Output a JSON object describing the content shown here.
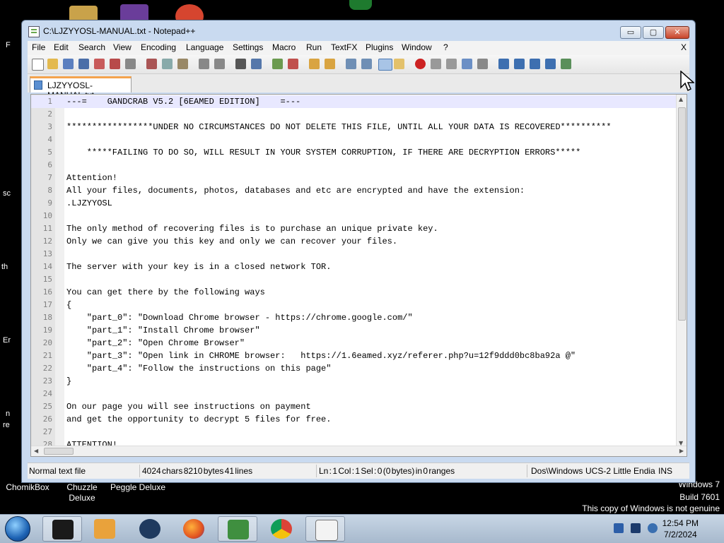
{
  "window": {
    "title": "C:\\LJZYYOSL-MANUAL.txt - Notepad++",
    "controls": {
      "minimize": "▭",
      "maximize": "▢",
      "close": "✕"
    }
  },
  "menu": {
    "items": [
      "File",
      "Edit",
      "Search",
      "View",
      "Encoding",
      "Language",
      "Settings",
      "Macro",
      "Run",
      "TextFX",
      "Plugins",
      "Window",
      "?"
    ],
    "close_doc": "X"
  },
  "tab": {
    "label": "LJZYYOSL-MANUAL.txt"
  },
  "editor": {
    "lines": [
      "---=    GANDCRAB V5.2 [6EAMED EDITION]    =---",
      "",
      "*****************UNDER NO CIRCUMSTANCES DO NOT DELETE THIS FILE, UNTIL ALL YOUR DATA IS RECOVERED**********",
      "",
      "    *****FAILING TO DO SO, WILL RESULT IN YOUR SYSTEM CORRUPTION, IF THERE ARE DECRYPTION ERRORS*****",
      "",
      "Attention!",
      "All your files, documents, photos, databases and etc are encrypted and have the extension:",
      ".LJZYYOSL",
      "",
      "The only method of recovering files is to purchase an unique private key.",
      "Only we can give you this key and only we can recover your files.",
      "",
      "The server with your key is in a closed network TOR.",
      "",
      "You can get there by the following ways",
      "{",
      "    \"part_0\": \"Download Chrome browser - https://chrome.google.com/\"",
      "    \"part_1\": \"Install Chrome browser\"",
      "    \"part_2\": \"Open Chrome Browser\"",
      "    \"part_3\": \"Open link in CHROME browser:   https://1.6eamed.xyz/referer.php?u=12f9ddd0bc8ba92a @\"",
      "    \"part_4\": \"Follow the instructions on this page\"",
      "}",
      "",
      "On our page you will see instructions on payment",
      "and get the opportunity to decrypt 5 files for free.",
      "",
      "ATTENTION!"
    ]
  },
  "status": {
    "type": "Normal text file",
    "counts": "4024 chars   8210 bytes   41 lines",
    "position": "Ln : 1    Col : 1    Sel : 0 (0 bytes) in 0 ranges",
    "eol": "Dos\\Windows",
    "encoding": "UCS-2 Little Endia",
    "mode": "INS"
  },
  "desktop": {
    "icons": [
      {
        "label": "ChomikBox"
      },
      {
        "label": "Chuzzle\nDeluxe"
      },
      {
        "label": "Peggle Deluxe"
      }
    ],
    "edge_text": [
      "F",
      "sc",
      "th",
      "Er",
      "n",
      "re"
    ],
    "watermark": [
      "Windows 7",
      "Build 7601",
      "This copy of Windows is not genuine"
    ]
  },
  "taskbar": {
    "clock_time": "12:54 PM",
    "clock_date": "7/2/2024",
    "apps": [
      "terminal",
      "media-player",
      "game-orb",
      "firefox",
      "people",
      "chrome",
      "notepad-plus-plus"
    ]
  },
  "colors": {
    "accent_tab": "#f4a34d",
    "current_line": "#e8e8ff",
    "taskbar": "#b7c7d9"
  }
}
